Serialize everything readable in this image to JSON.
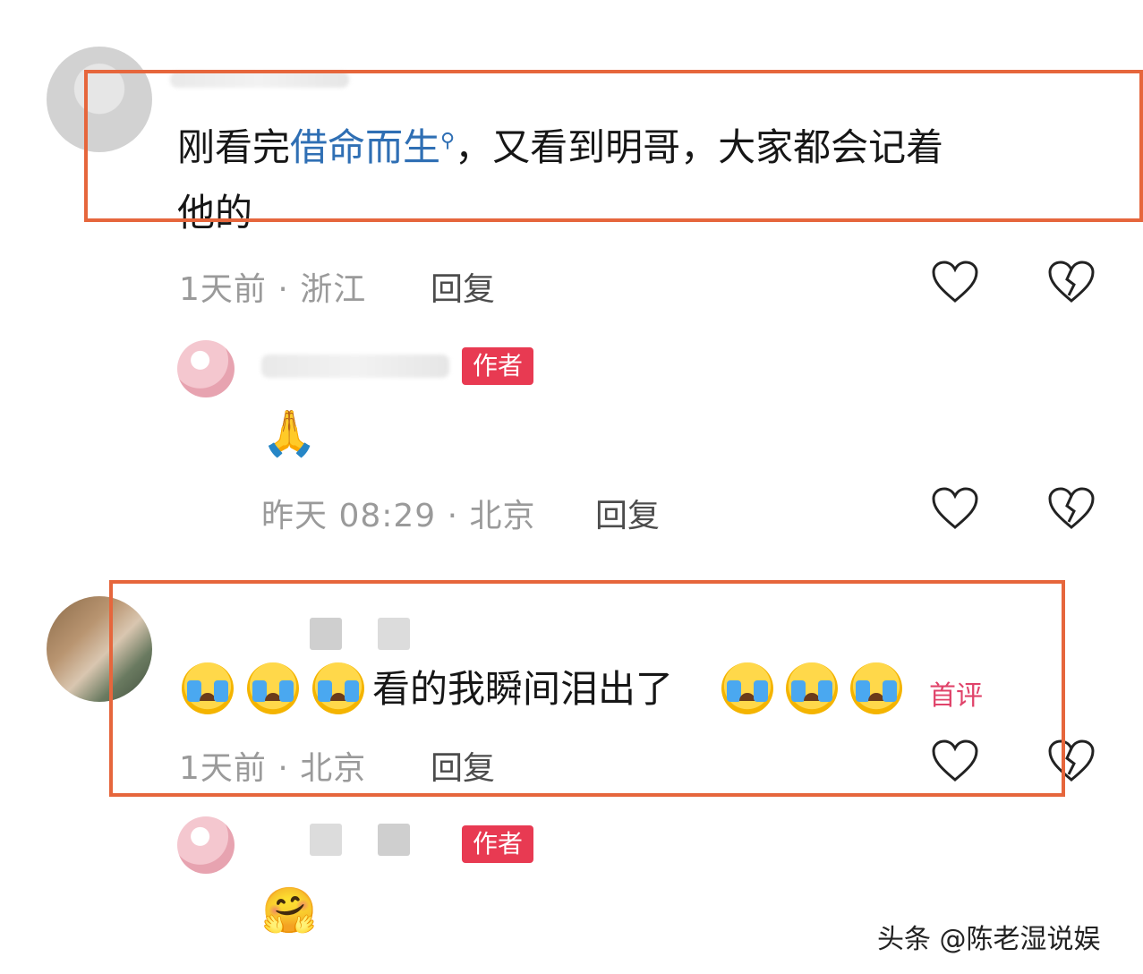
{
  "comments": [
    {
      "text_prefix": "刚看完",
      "link_text": "借命而生",
      "text_suffix": "，又看到明哥，大家都会记着",
      "text_line2": "他的",
      "meta": "1天前 · 浙江",
      "reply_label": "回复"
    },
    {
      "badge": "作者",
      "emoji": "🙏",
      "meta": "昨天 08:29 · 北京",
      "reply_label": "回复"
    },
    {
      "text": "看的我瞬间泪出了",
      "tag": "首评",
      "meta": "1天前 · 北京",
      "reply_label": "回复"
    },
    {
      "badge": "作者",
      "emoji": "🤗"
    }
  ],
  "watermark": "头条 @陈老湿说娱",
  "colors": {
    "highlight_box": "#e6663c",
    "badge_bg": "#e83a52",
    "link": "#2f6fb4",
    "first_tag": "#e0436a"
  }
}
